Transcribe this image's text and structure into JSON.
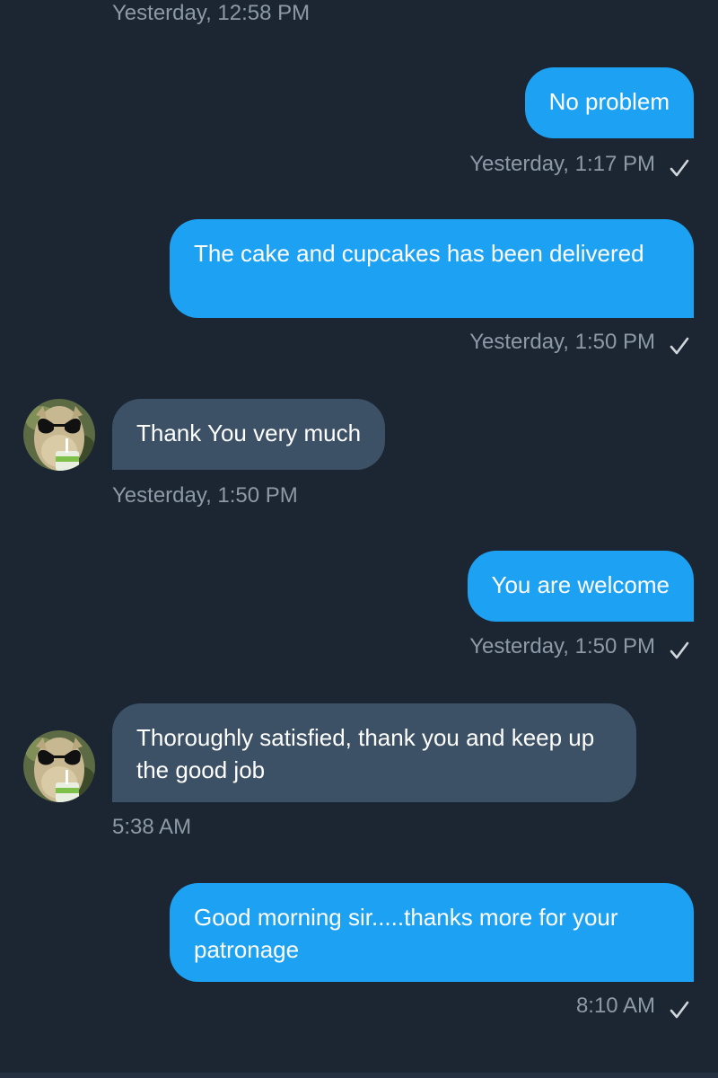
{
  "colors": {
    "background": "#1c2633",
    "outgoing_bubble": "#1da1f2",
    "incoming_bubble": "#3d5166",
    "timestamp": "#8d99a6"
  },
  "messages": [
    {
      "direction": "incoming",
      "timestamp": "Yesterday, 12:58 PM"
    },
    {
      "direction": "outgoing",
      "text": "No problem",
      "timestamp": "Yesterday, 1:17 PM",
      "read_icon": "check-icon"
    },
    {
      "direction": "outgoing",
      "text": "The cake and cupcakes has been delivered",
      "timestamp": "Yesterday, 1:50 PM",
      "read_icon": "check-icon"
    },
    {
      "direction": "incoming",
      "text": "Thank You very much",
      "timestamp": "Yesterday, 1:50 PM",
      "avatar": "llama-avatar"
    },
    {
      "direction": "outgoing",
      "text": "You are welcome",
      "timestamp": "Yesterday, 1:50 PM",
      "read_icon": "check-icon"
    },
    {
      "direction": "incoming",
      "text": "Thoroughly satisfied, thank you and keep up the good job",
      "timestamp": "5:38 AM",
      "avatar": "llama-avatar"
    },
    {
      "direction": "outgoing",
      "text": "Good morning sir.....thanks more for your patronage",
      "timestamp": "8:10 AM",
      "read_icon": "check-icon"
    }
  ]
}
